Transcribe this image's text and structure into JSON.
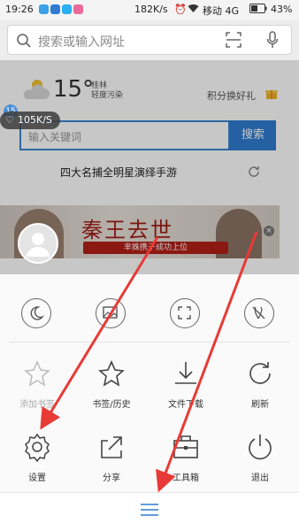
{
  "status_bar": {
    "time": "19:26",
    "speed": "182K/s",
    "carrier": "移动 4G",
    "battery": "43%"
  },
  "top_search": {
    "placeholder": "搜索或输入网址"
  },
  "weather": {
    "temperature": "15°",
    "city": "桂林",
    "air": "轻度污染"
  },
  "points_gift": "积分换好礼",
  "keyword_search": {
    "placeholder": "输入关键词",
    "button": "搜索"
  },
  "hot_topic": "四大名捕全明星演绎手游",
  "banner": {
    "title": "秦王去世",
    "subtitle": "芈姝携子成功上位"
  },
  "speed_badge": "105K/S",
  "weather_badge": "15",
  "menu": {
    "row2": [
      {
        "label": "添加书签",
        "icon": "star-outline-icon",
        "disabled": true
      },
      {
        "label": "书签/历史",
        "icon": "star-icon",
        "disabled": false
      },
      {
        "label": "文件下载",
        "icon": "download-icon",
        "disabled": false
      },
      {
        "label": "刷新",
        "icon": "refresh-icon",
        "disabled": false
      }
    ],
    "row3": [
      {
        "label": "设置",
        "icon": "gear-icon"
      },
      {
        "label": "分享",
        "icon": "share-icon"
      },
      {
        "label": "工具箱",
        "icon": "toolbox-icon"
      },
      {
        "label": "退出",
        "icon": "power-icon"
      }
    ]
  },
  "colors": {
    "accent_blue": "#2f7cd0",
    "arrow_red": "#e83a36"
  }
}
